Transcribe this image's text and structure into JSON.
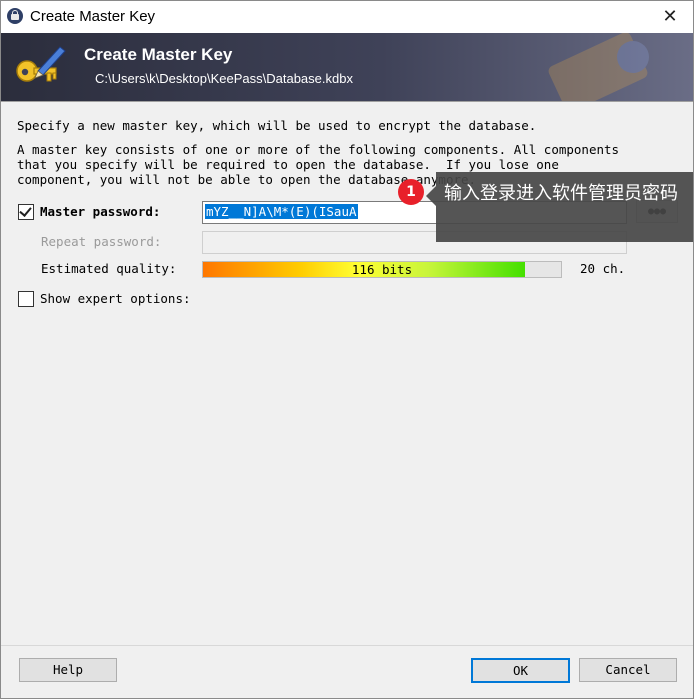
{
  "window": {
    "title": "Create Master Key",
    "close_glyph": "✕"
  },
  "banner": {
    "heading": "Create Master Key",
    "path": "C:\\Users\\k\\Desktop\\KeePass\\Database.kdbx",
    "icon": "key-pen-icon"
  },
  "intro": {
    "line1": "Specify a new master key, which will be used to encrypt the database.",
    "line2": "A master key consists of one or more of the following components. All components\nthat you specify will be required to open the database.  If you lose one\ncomponent, you will not be able to open the database anymore."
  },
  "master_password": {
    "checked": true,
    "label": "Master password:",
    "value": "mYZ__N]A\\M*(E)(ISauA",
    "reveal_label": "●●●"
  },
  "repeat_password": {
    "label": "Repeat password:",
    "value": ""
  },
  "quality": {
    "label": "Estimated quality:",
    "bar_text": "116 bits",
    "level_percent": 90,
    "chars": "20 ch."
  },
  "expert": {
    "checked": false,
    "label": "Show expert options:"
  },
  "buttons": {
    "help": "Help",
    "ok": "OK",
    "cancel": "Cancel"
  },
  "annotation": {
    "badge": "1",
    "text": "输入登录进入软件管理员密码"
  },
  "colors": {
    "selection": "#0078d7",
    "badge": "#e8202a"
  }
}
